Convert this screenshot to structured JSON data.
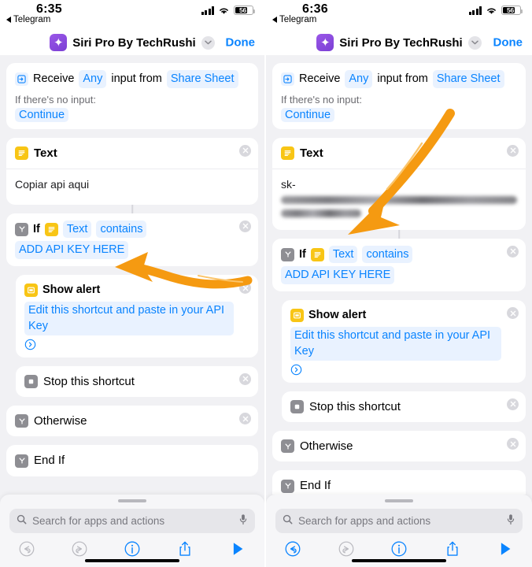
{
  "panels": [
    {
      "id": "left",
      "status": {
        "time": "6:35",
        "back_app": "Telegram",
        "battery_pct": "56"
      },
      "nav": {
        "title": "Siri Pro By TechRushi",
        "done_label": "Done",
        "app_icon": "siri-sparkle-icon",
        "chevron_icon": "chevron-down-icon"
      },
      "actions": {
        "receive": {
          "icon": "receive-input-icon",
          "word_receive": "Receive",
          "chip_any": "Any",
          "word_input_from": "input from",
          "chip_share_sheet": "Share Sheet",
          "no_input_label": "If there's no input:",
          "no_input_value": "Continue"
        },
        "text": {
          "icon": "text-action-icon",
          "title": "Text",
          "body": "Copiar api aqui",
          "redacted": false,
          "close_icon": "close-icon"
        },
        "if": {
          "icon": "if-condition-icon",
          "word_if": "If",
          "var_icon": "text-action-icon",
          "var_label": "Text",
          "operator": "contains",
          "value": "ADD API KEY HERE",
          "close_icon": "close-icon"
        },
        "alert": {
          "icon": "show-alert-icon",
          "title": "Show alert",
          "message": "Edit this shortcut and paste in your API Key",
          "disclosure_icon": "chevron-right-circle-icon",
          "close_icon": "close-icon"
        },
        "stop": {
          "icon": "stop-shortcut-icon",
          "title": "Stop this shortcut",
          "close_icon": "close-icon"
        },
        "otherwise": {
          "icon": "if-condition-icon",
          "title": "Otherwise",
          "close_icon": "close-icon"
        },
        "endif": {
          "icon": "if-condition-icon",
          "title": "End If"
        }
      },
      "sheet": {
        "search_placeholder": "Search for apps and actions",
        "search_icon": "search-icon",
        "mic_icon": "microphone-icon",
        "tools": [
          {
            "name": "undo-button",
            "icon": "undo-icon",
            "active": false
          },
          {
            "name": "redo-button",
            "icon": "redo-icon",
            "active": false
          },
          {
            "name": "info-button",
            "icon": "info-circle-icon",
            "active": true
          },
          {
            "name": "share-button",
            "icon": "share-icon",
            "active": true
          },
          {
            "name": "play-button",
            "icon": "play-icon",
            "active": true
          }
        ]
      },
      "annotation": {
        "arrow_icon": "orange-arrow-left",
        "color": "#F59A11"
      }
    },
    {
      "id": "right",
      "status": {
        "time": "6:36",
        "back_app": "Telegram",
        "battery_pct": "56"
      },
      "nav": {
        "title": "Siri Pro By TechRushi",
        "done_label": "Done",
        "app_icon": "siri-sparkle-icon",
        "chevron_icon": "chevron-down-icon"
      },
      "actions": {
        "receive": {
          "icon": "receive-input-icon",
          "word_receive": "Receive",
          "chip_any": "Any",
          "word_input_from": "input from",
          "chip_share_sheet": "Share Sheet",
          "no_input_label": "If there's no input:",
          "no_input_value": "Continue"
        },
        "text": {
          "icon": "text-action-icon",
          "title": "Text",
          "body": "sk-",
          "redacted": true,
          "close_icon": "close-icon"
        },
        "if": {
          "icon": "if-condition-icon",
          "word_if": "If",
          "var_icon": "text-action-icon",
          "var_label": "Text",
          "operator": "contains",
          "value": "ADD API KEY HERE",
          "close_icon": "close-icon"
        },
        "alert": {
          "icon": "show-alert-icon",
          "title": "Show alert",
          "message": "Edit this shortcut and paste in your API Key",
          "disclosure_icon": "chevron-right-circle-icon",
          "close_icon": "close-icon"
        },
        "stop": {
          "icon": "stop-shortcut-icon",
          "title": "Stop this shortcut",
          "close_icon": "close-icon"
        },
        "otherwise": {
          "icon": "if-condition-icon",
          "title": "Otherwise",
          "close_icon": "close-icon"
        },
        "endif": {
          "icon": "if-condition-icon",
          "title": "End If"
        }
      },
      "sheet": {
        "search_placeholder": "Search for apps and actions",
        "search_icon": "search-icon",
        "mic_icon": "microphone-icon",
        "tools": [
          {
            "name": "undo-button",
            "icon": "undo-icon",
            "active": true
          },
          {
            "name": "redo-button",
            "icon": "redo-icon",
            "active": false
          },
          {
            "name": "info-button",
            "icon": "info-circle-icon",
            "active": true
          },
          {
            "name": "share-button",
            "icon": "share-icon",
            "active": true
          },
          {
            "name": "play-button",
            "icon": "play-icon",
            "active": true
          }
        ]
      },
      "annotation": {
        "arrow_icon": "orange-arrow-down-left",
        "color": "#F59A11"
      }
    }
  ],
  "theme": {
    "accent_blue": "#0A84FF",
    "chip_bg": "#E9F2FF",
    "canvas_bg": "#F1F1F4",
    "annotation_orange": "#F59A11",
    "yellow_icon": "#F8C515",
    "gray_icon": "#8E8E93"
  }
}
